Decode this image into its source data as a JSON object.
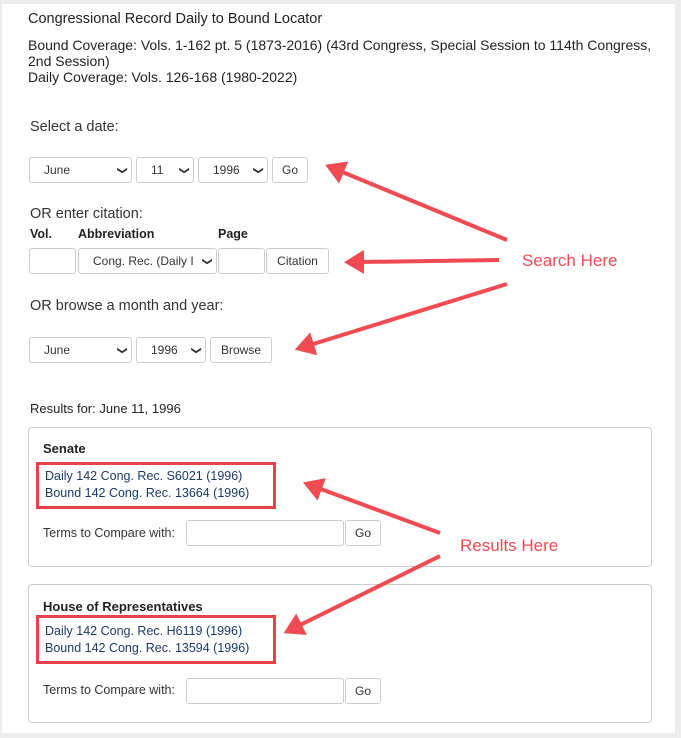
{
  "header": {
    "title": "Congressional Record Daily to Bound Locator",
    "bound_coverage": "Bound Coverage: Vols. 1-162 pt. 5 (1873-2016) (43rd Congress, Special Session to 114th Congress, 2nd Session)",
    "daily_coverage": "Daily Coverage: Vols. 126-168 (1980-2022)"
  },
  "date_search": {
    "label": "Select a date:",
    "month": "June",
    "day": "11",
    "year": "1996",
    "go_label": "Go"
  },
  "citation_search": {
    "label": "OR enter citation:",
    "vol_label": "Vol.",
    "abbr_label": "Abbreviation",
    "page_label": "Page",
    "vol_value": "",
    "abbreviation": "Cong. Rec. (Daily I",
    "page_value": "",
    "button_label": "Citation"
  },
  "browse": {
    "label": "OR browse a month and year:",
    "month": "June",
    "year": "1996",
    "button_label": "Browse"
  },
  "results": {
    "heading": "Results for: June 11, 1996",
    "panels": [
      {
        "title": "Senate",
        "links": [
          "Daily 142 Cong. Rec. S6021 (1996)",
          "Bound 142 Cong. Rec. 13664 (1996)"
        ],
        "terms_label": "Terms to Compare with:",
        "terms_value": "",
        "go_label": "Go"
      },
      {
        "title": "House of Representatives",
        "links": [
          "Daily 142 Cong. Rec. H6119 (1996)",
          "Bound 142 Cong. Rec. 13594 (1996)"
        ],
        "terms_label": "Terms to Compare with:",
        "terms_value": "",
        "go_label": "Go"
      }
    ]
  },
  "annotations": {
    "search_here": "Search Here",
    "results_here": "Results Here",
    "color": "#f04a52"
  },
  "icons": {
    "chevron": "❯"
  }
}
